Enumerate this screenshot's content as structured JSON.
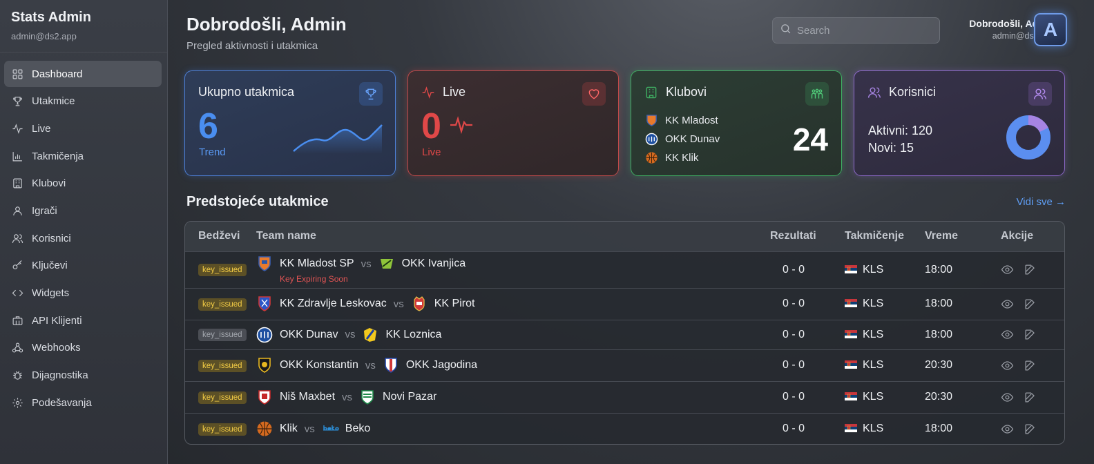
{
  "sidebar": {
    "app_name": "Stats Admin",
    "email": "admin@ds2.app",
    "items": [
      {
        "label": "Dashboard",
        "icon": "grid-icon"
      },
      {
        "label": "Utakmice",
        "icon": "trophy-icon"
      },
      {
        "label": "Live",
        "icon": "activity-icon"
      },
      {
        "label": "Takmičenja",
        "icon": "bar-chart-icon"
      },
      {
        "label": "Klubovi",
        "icon": "building-icon"
      },
      {
        "label": "Igrači",
        "icon": "user-icon"
      },
      {
        "label": "Korisnici",
        "icon": "users-icon"
      },
      {
        "label": "Ključevi",
        "icon": "key-icon"
      },
      {
        "label": "Widgets",
        "icon": "code-icon"
      },
      {
        "label": "API Klijenti",
        "icon": "briefcase-icon"
      },
      {
        "label": "Webhooks",
        "icon": "webhook-icon"
      },
      {
        "label": "Dijagnostika",
        "icon": "bug-icon"
      },
      {
        "label": "Podešavanja",
        "icon": "gear-icon"
      }
    ]
  },
  "header": {
    "title": "Dobrodošli, Admin",
    "subtitle": "Pregled aktivnosti i utakmica",
    "search_placeholder": "Search",
    "user_name": "Dobrodošli, Admin",
    "user_email": "admin@ds2.app",
    "avatar_letter": "A"
  },
  "cards": {
    "matches": {
      "title": "Ukupno utakmica",
      "value": "6",
      "footer": "Trend",
      "color": "#4a8ef0"
    },
    "live": {
      "title": "Live",
      "value": "0",
      "footer": "Live",
      "color": "#e04848"
    },
    "clubs": {
      "title": "Klubovi",
      "count": "24",
      "clubs": [
        "KK Mladost",
        "OKK Dunav",
        "KK Klik"
      ],
      "color": "#3fae62"
    },
    "users": {
      "title": "Korisnici",
      "active": "Aktivni: 120",
      "new": "Novi: 15",
      "active_count": 120,
      "new_count": 15,
      "color": "#9a72d8"
    }
  },
  "upcoming": {
    "title": "Predstojeće utakmice",
    "view_all": "Vidi sve →",
    "columns": [
      "Bedževi",
      "Team name",
      "Rezultati",
      "Takmičenje",
      "Vreme",
      "Akcije"
    ],
    "rows": [
      {
        "badge": "key_issued",
        "badge_muted": false,
        "home": "KK Mladost SP",
        "vs": "vs",
        "away": "OKK Ivanjica",
        "warning": "Key Expiring Soon",
        "result": "0 - 0",
        "competition": "KLS",
        "time": "18:00"
      },
      {
        "badge": "key_issued",
        "badge_muted": false,
        "home": "KK Zdravlje Leskovac",
        "vs": "vs",
        "away": "KK Pirot",
        "warning": "",
        "result": "0 - 0",
        "competition": "KLS",
        "time": "18:00"
      },
      {
        "badge": "key_issued",
        "badge_muted": true,
        "home": "OKK Dunav",
        "vs": "vs",
        "away": "KK Loznica",
        "warning": "",
        "result": "0 - 0",
        "competition": "KLS",
        "time": "18:00"
      },
      {
        "badge": "key_issued",
        "badge_muted": false,
        "home": "OKK Konstantin",
        "vs": "vs",
        "away": "OKK Jagodina",
        "warning": "",
        "result": "0 - 0",
        "competition": "KLS",
        "time": "20:30"
      },
      {
        "badge": "key_issued",
        "badge_muted": false,
        "home": "Niš Maxbet",
        "vs": "vs",
        "away": "Novi Pazar",
        "warning": "",
        "result": "0 - 0",
        "competition": "KLS",
        "time": "20:30"
      },
      {
        "badge": "key_issued",
        "badge_muted": false,
        "home": "Klik",
        "vs": "vs",
        "away": "Beko",
        "warning": "",
        "result": "0 - 0",
        "competition": "KLS",
        "time": "18:00"
      }
    ]
  }
}
